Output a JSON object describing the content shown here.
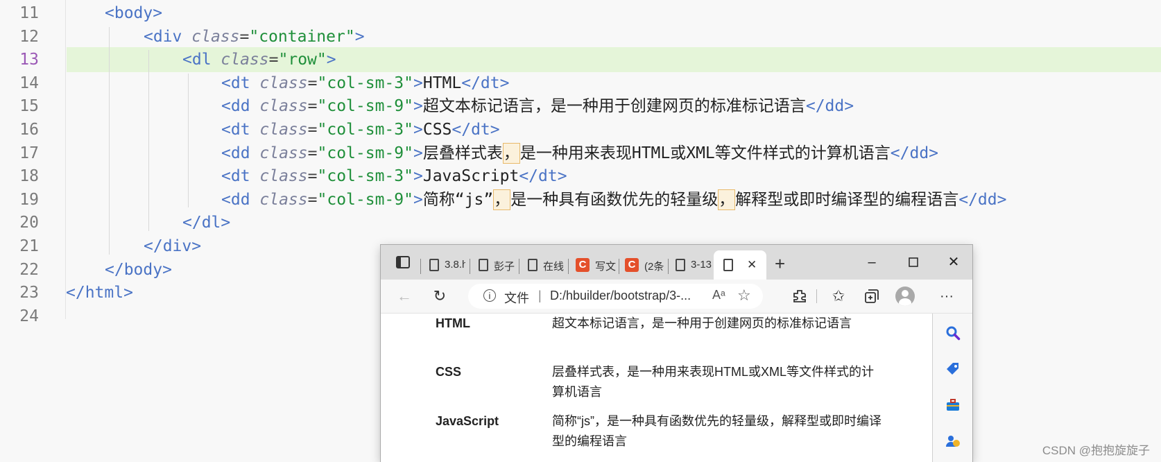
{
  "editor": {
    "lines": [
      {
        "num": "11",
        "indent": 2,
        "tokens": [
          [
            "tag",
            "<body>"
          ]
        ]
      },
      {
        "num": "12",
        "indent": 4,
        "tokens": [
          [
            "tag",
            "<div "
          ],
          [
            "attr",
            "class"
          ],
          [
            "eq",
            "="
          ],
          [
            "str",
            "\"container\""
          ],
          [
            "tag",
            ">"
          ]
        ]
      },
      {
        "num": "13",
        "indent": 6,
        "tokens": [
          [
            "tag",
            "<dl "
          ],
          [
            "attr",
            "class"
          ],
          [
            "eq",
            "="
          ],
          [
            "str",
            "\"row\""
          ],
          [
            "tag",
            ">"
          ]
        ]
      },
      {
        "num": "14",
        "indent": 8,
        "tokens": [
          [
            "tag",
            "<dt "
          ],
          [
            "attr",
            "class"
          ],
          [
            "eq",
            "="
          ],
          [
            "str",
            "\"col-sm-3\""
          ],
          [
            "tag",
            ">"
          ],
          [
            "txt",
            "HTML"
          ],
          [
            "tag",
            "</dt>"
          ]
        ]
      },
      {
        "num": "15",
        "indent": 8,
        "tokens": [
          [
            "tag",
            "<dd "
          ],
          [
            "attr",
            "class"
          ],
          [
            "eq",
            "="
          ],
          [
            "str",
            "\"col-sm-9\""
          ],
          [
            "tag",
            ">"
          ],
          [
            "txt",
            "超文本标记语言，是一种用于创建网页的标准标记语言"
          ],
          [
            "tag",
            "</dd>"
          ]
        ]
      },
      {
        "num": "16",
        "indent": 8,
        "tokens": [
          [
            "tag",
            "<dt "
          ],
          [
            "attr",
            "class"
          ],
          [
            "eq",
            "="
          ],
          [
            "str",
            "\"col-sm-3\""
          ],
          [
            "tag",
            ">"
          ],
          [
            "txt",
            "CSS"
          ],
          [
            "tag",
            "</dt>"
          ]
        ]
      },
      {
        "num": "17",
        "indent": 8,
        "tokens": [
          [
            "tag",
            "<dd "
          ],
          [
            "attr",
            "class"
          ],
          [
            "eq",
            "="
          ],
          [
            "str",
            "\"col-sm-9\""
          ],
          [
            "tag",
            ">"
          ],
          [
            "txt",
            "层叠样式表"
          ],
          [
            "hl",
            "，"
          ],
          [
            "txt",
            "是一种用来表现HTML或XML等文件样式的计算机语言"
          ],
          [
            "tag",
            "</dd>"
          ]
        ]
      },
      {
        "num": "18",
        "indent": 8,
        "tokens": [
          [
            "tag",
            "<dt "
          ],
          [
            "attr",
            "class"
          ],
          [
            "eq",
            "="
          ],
          [
            "str",
            "\"col-sm-3\""
          ],
          [
            "tag",
            ">"
          ],
          [
            "txt",
            "JavaScript"
          ],
          [
            "tag",
            "</dt>"
          ]
        ]
      },
      {
        "num": "19",
        "indent": 8,
        "tokens": [
          [
            "tag",
            "<dd "
          ],
          [
            "attr",
            "class"
          ],
          [
            "eq",
            "="
          ],
          [
            "str",
            "\"col-sm-9\""
          ],
          [
            "tag",
            ">"
          ],
          [
            "txt",
            "简称“js”"
          ],
          [
            "hl",
            "，"
          ],
          [
            "txt",
            "是一种具有函数优先的轻量级"
          ],
          [
            "hl",
            "，"
          ],
          [
            "txt",
            "解释型或即时编译型的编程语言"
          ],
          [
            "tag",
            "</dd>"
          ]
        ]
      },
      {
        "num": "20",
        "indent": 6,
        "tokens": [
          [
            "tag",
            "</dl>"
          ]
        ]
      },
      {
        "num": "21",
        "indent": 4,
        "tokens": [
          [
            "tag",
            "</div>"
          ]
        ]
      },
      {
        "num": "22",
        "indent": 2,
        "tokens": [
          [
            "tag",
            "</body>"
          ]
        ]
      },
      {
        "num": "23",
        "indent": 0,
        "tokens": [
          [
            "tag",
            "</html>"
          ]
        ]
      },
      {
        "num": "24",
        "indent": 0,
        "tokens": []
      }
    ],
    "current_line": "13",
    "colors": {
      "tag": "#4a73c5",
      "string": "#1f8f3a",
      "attr": "#7a7f9a",
      "current_line_bg": "#e5f5d9"
    }
  },
  "browser": {
    "tabs": [
      {
        "icon": "doc-icon",
        "label": "3.8.h"
      },
      {
        "icon": "doc-icon",
        "label": "彭子"
      },
      {
        "icon": "doc-icon",
        "label": "在线"
      },
      {
        "icon": "csdn-icon",
        "label": "写文"
      },
      {
        "icon": "csdn-icon",
        "label": "(2条"
      },
      {
        "icon": "doc-icon",
        "label": "3-13"
      }
    ],
    "active_tab_close": "✕",
    "new_tab": "+",
    "address": {
      "label": "文件",
      "separator": "|",
      "url": "D:/hbuilder/bootstrap/3-..."
    },
    "read_aloud": "Aᵃ",
    "more": "···",
    "definitions": [
      {
        "term": "HTML",
        "desc": "超文本标记语言，是一种用于创建网页的标准标记语言"
      },
      {
        "term": "CSS",
        "desc": "层叠样式表，是一种用来表现HTML或XML等文件样式的计算机语言"
      },
      {
        "term": "JavaScript",
        "desc": "简称“js”，是一种具有函数优先的轻量级，解释型或即时编译型的编程语言"
      }
    ]
  },
  "watermark": "CSDN @抱抱旋旋子"
}
